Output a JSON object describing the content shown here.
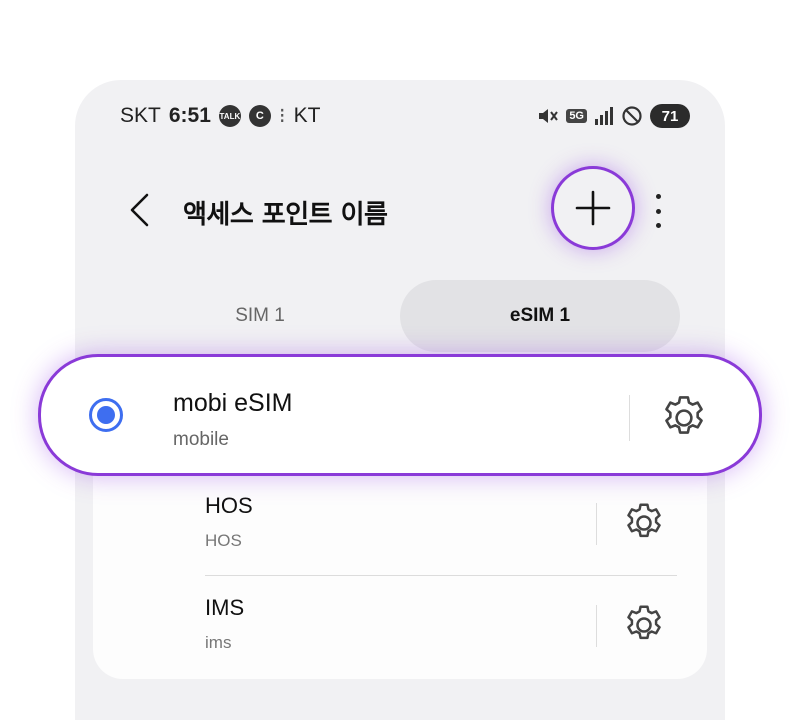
{
  "status_bar": {
    "carrier": "SKT",
    "time": "6:51",
    "talk_badge": "TALK",
    "c_badge": "C",
    "second_carrier": "KT",
    "network_label": "5G",
    "battery": "71"
  },
  "header": {
    "title": "액세스 포인트 이름"
  },
  "tabs": [
    {
      "label": "SIM 1",
      "active": false
    },
    {
      "label": "eSIM 1",
      "active": true
    }
  ],
  "selected_apn": {
    "name": "mobi eSIM",
    "apn": "mobile",
    "selected": true
  },
  "apn_list": [
    {
      "name": "HOS",
      "apn": "HOS"
    },
    {
      "name": "IMS",
      "apn": "ims"
    }
  ],
  "colors": {
    "accent_highlight": "#8a3ad8",
    "radio_blue": "#3e6ef0",
    "background": "#f1f1f3"
  }
}
